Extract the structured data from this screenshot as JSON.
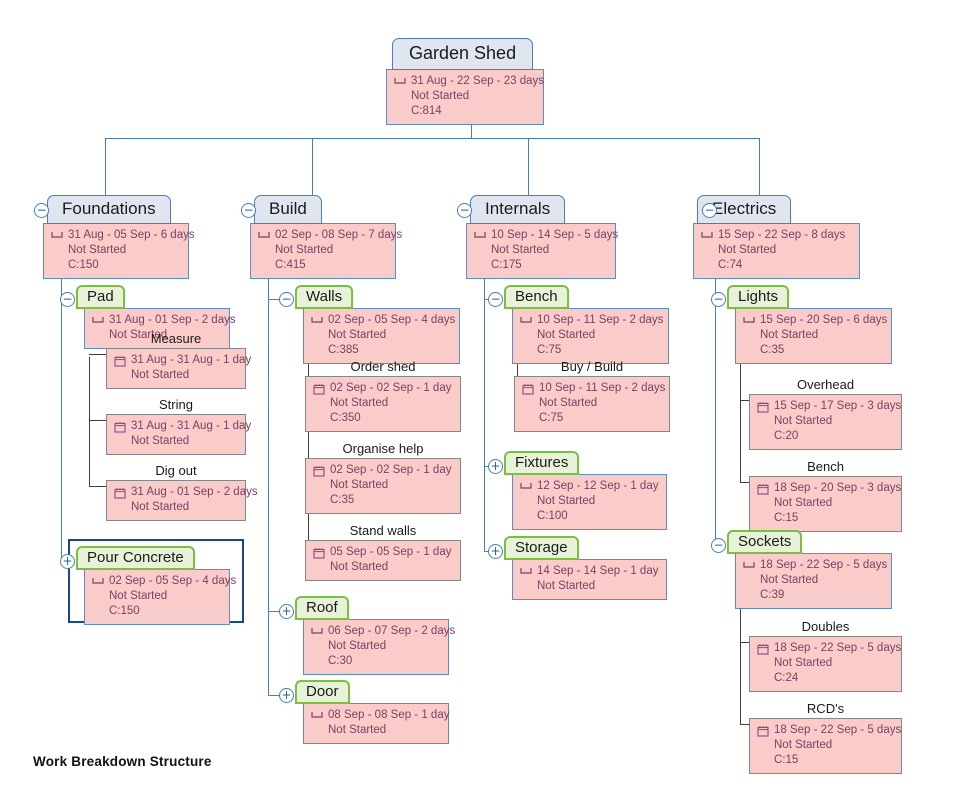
{
  "caption": "Work Breakdown Structure",
  "colors": {
    "node_header_blue_fill": "#dfe6ef",
    "node_header_blue_border": "#4a7ebb",
    "node_header_green_fill": "#e7f2d8",
    "node_header_green_border": "#7dbd42",
    "node_body_fill": "#f9ccc9",
    "node_body_border_blue": "#5b8cc4",
    "node_body_border_gray": "#868686",
    "body_text": "#7b3f63",
    "connector": "#4a7ebb",
    "connector_dark": "#3f3f3f",
    "selection": "#18478c"
  },
  "icons": {
    "summary": "summary-bar-icon",
    "task": "calendar-icon",
    "collapse": "minus-circle-icon",
    "expand": "plus-circle-icon"
  },
  "root": {
    "title": "Garden Shed",
    "dates": "31 Aug - 22 Sep - 23 days",
    "status": "Not Started",
    "cost": "C:814",
    "toggle": "−"
  },
  "branches": [
    {
      "title": "Foundations",
      "dates": "31 Aug - 05 Sep - 6 days",
      "status": "Not Started",
      "cost": "C:150",
      "toggle": "−",
      "children": [
        {
          "title": "Pad",
          "dates": "31 Aug - 01 Sep - 2 days",
          "status": "Not Started",
          "cost": "",
          "toggle": "−",
          "selected": false,
          "children": [
            {
              "title": "Measure",
              "dates": "31 Aug - 31 Aug - 1 day",
              "status": "Not Started",
              "cost": ""
            },
            {
              "title": "String",
              "dates": "31 Aug - 31 Aug - 1 day",
              "status": "Not Started",
              "cost": ""
            },
            {
              "title": "Dig out",
              "dates": "31 Aug - 01 Sep - 2 days",
              "status": "Not Started",
              "cost": ""
            }
          ]
        },
        {
          "title": "Pour Concrete",
          "dates": "02 Sep - 05 Sep - 4 days",
          "status": "Not Started",
          "cost": "C:150",
          "toggle": "+",
          "selected": true,
          "children": []
        }
      ]
    },
    {
      "title": "Build",
      "dates": "02 Sep - 08 Sep - 7 days",
      "status": "Not Started",
      "cost": "C:415",
      "toggle": "−",
      "children": [
        {
          "title": "Walls",
          "dates": "02 Sep - 05 Sep - 4 days",
          "status": "Not Started",
          "cost": "C:385",
          "toggle": "−",
          "selected": false,
          "children": [
            {
              "title": "Order shed",
              "dates": "02 Sep - 02 Sep - 1 day",
              "status": "Not Started",
              "cost": "C:350"
            },
            {
              "title": "Organise help",
              "dates": "02 Sep - 02 Sep - 1 day",
              "status": "Not Started",
              "cost": "C:35"
            },
            {
              "title": "Stand walls",
              "dates": "05 Sep - 05 Sep - 1 day",
              "status": "Not Started",
              "cost": ""
            }
          ]
        },
        {
          "title": "Roof",
          "dates": "06 Sep - 07 Sep - 2 days",
          "status": "Not Started",
          "cost": "C:30",
          "toggle": "+",
          "selected": false,
          "children": []
        },
        {
          "title": "Door",
          "dates": "08 Sep - 08 Sep - 1 day",
          "status": "Not Started",
          "cost": "",
          "toggle": "+",
          "selected": false,
          "children": []
        }
      ]
    },
    {
      "title": "Internals",
      "dates": "10 Sep - 14 Sep - 5 days",
      "status": "Not Started",
      "cost": "C:175",
      "toggle": "−",
      "children": [
        {
          "title": "Bench",
          "dates": "10 Sep - 11 Sep - 2 days",
          "status": "Not Started",
          "cost": "C:75",
          "toggle": "−",
          "selected": false,
          "children": [
            {
              "title": "Buy / Build",
              "dates": "10 Sep - 11 Sep - 2 days",
              "status": "Not Started",
              "cost": "C:75"
            }
          ]
        },
        {
          "title": "Fixtures",
          "dates": "12 Sep - 12 Sep - 1 day",
          "status": "Not Started",
          "cost": "C:100",
          "toggle": "+",
          "selected": false,
          "children": []
        },
        {
          "title": "Storage",
          "dates": "14 Sep - 14 Sep - 1 day",
          "status": "Not Started",
          "cost": "",
          "toggle": "+",
          "selected": false,
          "children": []
        }
      ]
    },
    {
      "title": "Electrics",
      "dates": "15 Sep - 22 Sep - 8 days",
      "status": "Not Started",
      "cost": "C:74",
      "toggle": "−",
      "children": [
        {
          "title": "Lights",
          "dates": "15 Sep - 20 Sep - 6 days",
          "status": "Not Started",
          "cost": "C:35",
          "toggle": "−",
          "selected": false,
          "children": [
            {
              "title": "Overhead",
              "dates": "15 Sep - 17 Sep - 3 days",
              "status": "Not Started",
              "cost": "C:20"
            },
            {
              "title": "Bench",
              "dates": "18 Sep - 20 Sep - 3 days",
              "status": "Not Started",
              "cost": "C:15"
            }
          ]
        },
        {
          "title": "Sockets",
          "dates": "18 Sep - 22 Sep - 5 days",
          "status": "Not Started",
          "cost": "C:39",
          "toggle": "−",
          "selected": false,
          "children": [
            {
              "title": "Doubles",
              "dates": "18 Sep - 22 Sep - 5 days",
              "status": "Not Started",
              "cost": "C:24"
            },
            {
              "title": "RCD's",
              "dates": "18 Sep - 22 Sep - 5 days",
              "status": "Not Started",
              "cost": "C:15"
            }
          ]
        }
      ]
    }
  ]
}
